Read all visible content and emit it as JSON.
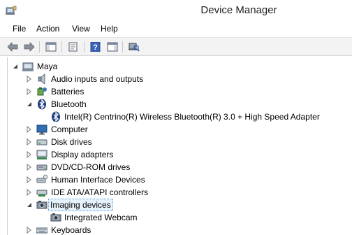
{
  "window": {
    "title": "Device Manager"
  },
  "menu": {
    "items": [
      "File",
      "Action",
      "View",
      "Help"
    ]
  },
  "toolbar": {
    "buttons": [
      "back-icon",
      "forward-icon",
      "show-hide-console-tree-icon",
      "properties-icon",
      "help-icon",
      "show-action-pane-icon",
      "scan-hardware-changes-icon"
    ]
  },
  "tree": {
    "root": "Maya",
    "categories": [
      {
        "label": "Audio inputs and outputs",
        "expanded": false
      },
      {
        "label": "Batteries",
        "expanded": false
      },
      {
        "label": "Bluetooth",
        "expanded": true,
        "children": [
          "Intel(R) Centrino(R) Wireless Bluetooth(R) 3.0 + High Speed Adapter"
        ]
      },
      {
        "label": "Computer",
        "expanded": false
      },
      {
        "label": "Disk drives",
        "expanded": false
      },
      {
        "label": "Display adapters",
        "expanded": false
      },
      {
        "label": "DVD/CD-ROM drives",
        "expanded": false
      },
      {
        "label": "Human Interface Devices",
        "expanded": false
      },
      {
        "label": "IDE ATA/ATAPI controllers",
        "expanded": false
      },
      {
        "label": "Imaging devices",
        "expanded": true,
        "selected": true,
        "children": [
          "Integrated Webcam"
        ]
      },
      {
        "label": "Keyboards",
        "expanded": false
      }
    ]
  },
  "colors": {
    "selection_border": "#6a9fd4",
    "selection_fill": "#e5f1fb",
    "toolbar_bg": "#f3f3f3"
  }
}
